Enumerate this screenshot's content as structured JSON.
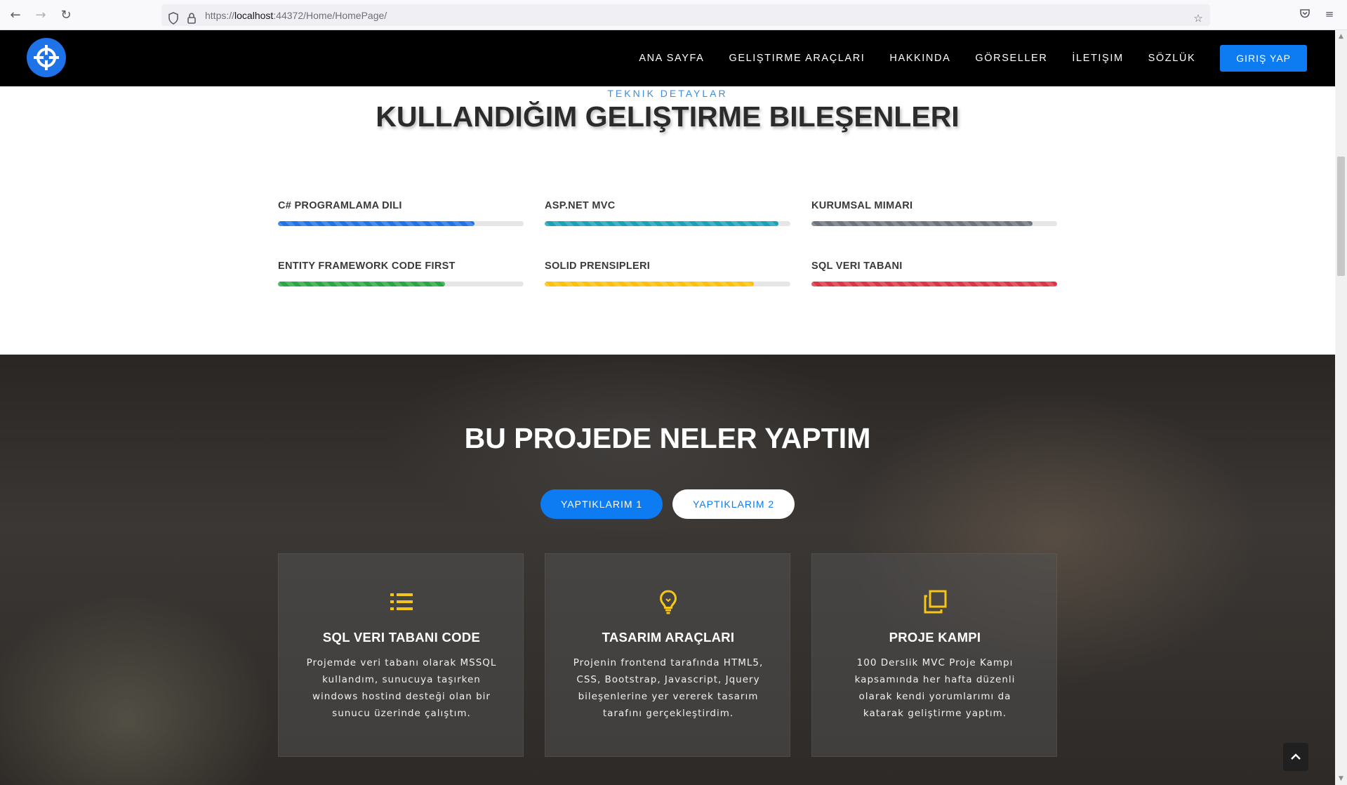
{
  "browser": {
    "url_prefix": "https://",
    "url_host": "localhost",
    "url_rest": ":44372/Home/HomePage/",
    "icons": [
      "back-arrow-icon",
      "forward-arrow-icon",
      "reload-icon",
      "shield-icon",
      "lock-icon",
      "star-icon",
      "pocket-icon",
      "menu-icon"
    ]
  },
  "header": {
    "nav_items": [
      "ANA SAYFA",
      "GELIŞTIRME ARAÇLARI",
      "HAKKINDA",
      "GÖRSELLER",
      "İLETIŞIM",
      "SÖZLÜK"
    ],
    "login_label": "GIRIŞ YAP"
  },
  "skills": {
    "kicker": "TEKNIK DETAYLAR",
    "title": "KULLANDIĞIM GELIŞTIRME BILEŞENLERI",
    "items": [
      {
        "label": "C# PROGRAMLAMA DILI",
        "percent": 80,
        "color": "#1e73e8"
      },
      {
        "label": "ASP.NET MVC",
        "percent": 95,
        "color": "#17a2b8"
      },
      {
        "label": "KURUMSAL MIMARI",
        "percent": 90,
        "color": "#6c757d"
      },
      {
        "label": "ENTITY FRAMEWORK CODE FIRST",
        "percent": 68,
        "color": "#28a745"
      },
      {
        "label": "SOLID PRENSIPLERI",
        "percent": 85,
        "color": "#ffc107"
      },
      {
        "label": "SQL VERI TABANI",
        "percent": 100,
        "color": "#dc3545"
      }
    ]
  },
  "projects": {
    "title": "BU PROJEDE NELER YAPTIM",
    "tabs": [
      "YAPTIKLARIM 1",
      "YAPTIKLARIM 2"
    ],
    "accent": "#f5c518",
    "cards": [
      {
        "icon": "list-icon",
        "title": "SQL VERI TABANI CODE",
        "text": "Projemde veri tabanı olarak MSSQL kullandım, sunucuya taşırken windows hostind desteği olan bir sunucu üzerinde çalıştım."
      },
      {
        "icon": "lightbulb-icon",
        "title": "TASARIM ARAÇLARI",
        "text": "Projenin frontend tarafında HTML5, CSS, Bootstrap, Javascript, Jquery bileşenlerine yer vererek tasarım tarafını gerçekleştirdim."
      },
      {
        "icon": "copy-icon",
        "title": "PROJE KAMPI",
        "text": "100 Derslik MVC Proje Kampı kapsamında her hafta düzenli olarak kendi yorumlarımı da katarak geliştirme yaptım."
      }
    ]
  }
}
